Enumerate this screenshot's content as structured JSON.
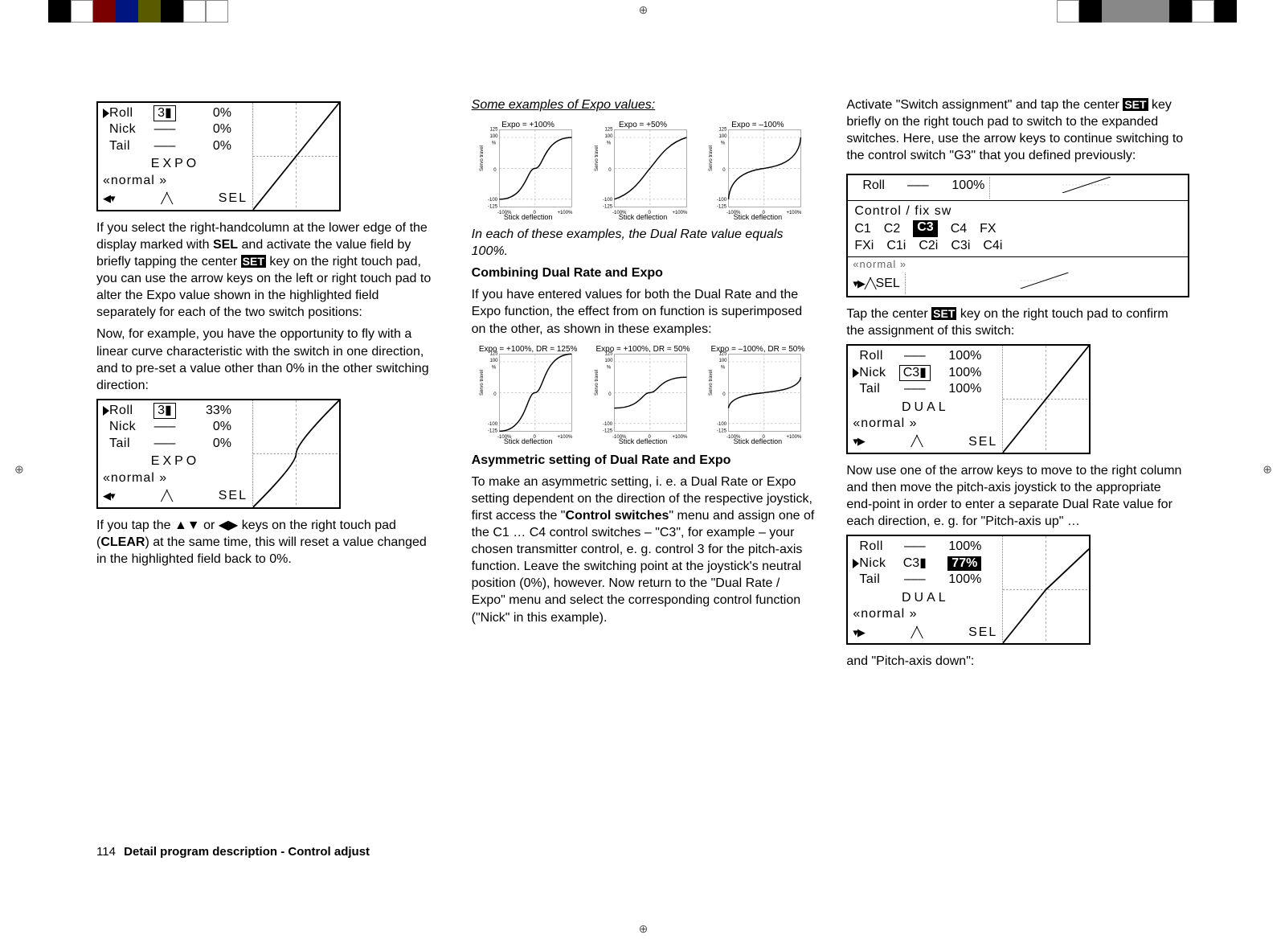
{
  "footer": {
    "page_number": "114",
    "text": "Detail program description - Control adjust"
  },
  "colors": {
    "set_key_bg": "#000000",
    "set_key_fg": "#ffffff"
  },
  "column1": {
    "lcd1": {
      "rows": [
        {
          "label": "Roll",
          "sw": "3",
          "boxed": true,
          "pct": "0%",
          "selected": true
        },
        {
          "label": "Nick",
          "sw": "–––",
          "boxed": false,
          "pct": "0%"
        },
        {
          "label": "Tail",
          "sw": "–––",
          "boxed": false,
          "pct": "0%"
        }
      ],
      "mode": "EXPO",
      "phase": "«normal »",
      "sel": "SEL"
    },
    "p1a": "If you select the right-handcolumn at the lower edge of the display marked with ",
    "p1_sel": "SEL",
    "p1b": " and activate the value field by briefly tapping the center ",
    "p1_set": "SET",
    "p1c": " key on the right touch pad, you can use the arrow keys on the left or right touch pad to alter the Expo value shown in the highlighted field separately for each of the two switch positions:",
    "p2": "Now, for example, you have the opportunity to fly with a linear curve characteristic with the switch in one direction, and to pre-set a value other than 0% in the other switching direction:",
    "lcd2": {
      "rows": [
        {
          "label": "Roll",
          "sw": "3",
          "boxed": true,
          "pct": "33%",
          "selected": true
        },
        {
          "label": "Nick",
          "sw": "–––",
          "boxed": false,
          "pct": "0%"
        },
        {
          "label": "Tail",
          "sw": "–––",
          "boxed": false,
          "pct": "0%"
        }
      ],
      "mode": "EXPO",
      "phase": "«normal »",
      "sel": "SEL"
    },
    "p3a": "If you tap the ▲▼ or ◀▶ keys on the right touch pad (",
    "p3_clear": "CLEAR",
    "p3b": ") at the same time, this will reset a value changed in the highlighted field back to 0%."
  },
  "column2": {
    "heading1": "Some examples of Expo values:",
    "charts1": [
      {
        "title": "Expo = +100%",
        "xlabel": "Stick deflection"
      },
      {
        "title": "Expo = +50%",
        "xlabel": "Stick deflection"
      },
      {
        "title": "Expo = –100%",
        "xlabel": "Stick deflection"
      }
    ],
    "caption1": "In each of these examples, the Dual Rate value equals 100%.",
    "heading2": "Combining Dual Rate and Expo",
    "p1": "If you have entered values for both the Dual Rate and the Expo function, the effect from on function is superimposed on the other, as shown in these examples:",
    "charts2": [
      {
        "title": "Expo = +100%, DR = 125%",
        "xlabel": "Stick deflection"
      },
      {
        "title": "Expo = +100%, DR = 50%",
        "xlabel": "Stick deflection"
      },
      {
        "title": "Expo = –100%, DR = 50%",
        "xlabel": "Stick deflection"
      }
    ],
    "heading3": "Asymmetric setting of Dual Rate and Expo",
    "p2a": "To make an asymmetric setting, i. e. a Dual Rate or Expo setting dependent on the direction of the respective joystick, first access the \"",
    "p2_bold": "Control switches",
    "p2b": "\" menu and assign one of the C1 … C4 control switches – \"C3\", for example – your chosen transmitter control, e. g. control 3 for the pitch-axis function. Leave the switching point at the joystick's neutral position (0%), however. Now return to the \"Dual Rate / Expo\" menu and select the corresponding control function (\"Nick\" in this example)."
  },
  "column3": {
    "p1a": "Activate \"Switch assignment\" and tap the center ",
    "p1_set": "SET",
    "p1b": " key briefly on the right touch pad to switch to the expanded switches. Here, use the arrow keys to continue switching to the control switch \"G3\" that you defined previously:",
    "lcd_sw": {
      "top_label": "Roll",
      "top_sw": "–––",
      "top_pct": "100%",
      "title": "Control / fix  sw",
      "row1": [
        "C1",
        "C2",
        "C3",
        "C4",
        "FX"
      ],
      "row1_selected_index": 2,
      "row2": [
        "FXi",
        "C1i",
        "C2i",
        "C3i",
        "C4i"
      ],
      "under": "«normal »",
      "sel": "SEL"
    },
    "p2a": "Tap the center ",
    "p2_set": "SET",
    "p2b": " key on the right touch pad to confirm the assignment of this switch:",
    "lcd2": {
      "rows": [
        {
          "label": "Roll",
          "sw": "–––",
          "boxed": false,
          "pct": "100%"
        },
        {
          "label": "Nick",
          "sw": "C3",
          "boxed": true,
          "pct": "100%",
          "selected": true
        },
        {
          "label": "Tail",
          "sw": "–––",
          "boxed": false,
          "pct": "100%"
        }
      ],
      "mode": "DUAL",
      "phase": "«normal »",
      "sel": "SEL"
    },
    "p3": "Now use one of the arrow keys to move to the right column and then move the pitch-axis joystick to the appropriate end-point in order to enter a separate Dual Rate value for each direction, e. g. for \"Pitch-axis up\" …",
    "lcd3": {
      "rows": [
        {
          "label": "Roll",
          "sw": "–––",
          "boxed": false,
          "pct": "100%"
        },
        {
          "label": "Nick",
          "sw": "C3",
          "boxed": false,
          "pct": "77%",
          "selected": true,
          "pct_inverted": true
        },
        {
          "label": "Tail",
          "sw": "–––",
          "boxed": false,
          "pct": "100%"
        }
      ],
      "mode": "DUAL",
      "phase": "«normal »",
      "sel": "SEL"
    },
    "p4": "and \"Pitch-axis down\":"
  },
  "chart_data": [
    {
      "type": "line",
      "title": "Expo = +100%",
      "xlabel": "Stick deflection",
      "ylabel": "Servo travel",
      "xlim": [
        -100,
        100
      ],
      "ylim": [
        -125,
        125
      ],
      "xticks": [
        "-100%",
        "0",
        "+100%"
      ],
      "yticks": [
        -125,
        -100,
        0,
        100,
        125
      ],
      "x": [
        -100,
        -75,
        -50,
        -25,
        0,
        25,
        50,
        75,
        100
      ],
      "y": [
        -100,
        -42,
        -12,
        -2,
        0,
        2,
        12,
        42,
        100
      ]
    },
    {
      "type": "line",
      "title": "Expo = +50%",
      "xlabel": "Stick deflection",
      "ylabel": "Servo travel",
      "xlim": [
        -100,
        100
      ],
      "ylim": [
        -125,
        125
      ],
      "xticks": [
        "-100%",
        "0",
        "+100%"
      ],
      "yticks": [
        -125,
        -100,
        0,
        100,
        125
      ],
      "x": [
        -100,
        -75,
        -50,
        -25,
        0,
        25,
        50,
        75,
        100
      ],
      "y": [
        -100,
        -58,
        -30,
        -13,
        0,
        13,
        30,
        58,
        100
      ]
    },
    {
      "type": "line",
      "title": "Expo = –100%",
      "xlabel": "Stick deflection",
      "ylabel": "Servo travel",
      "xlim": [
        -100,
        100
      ],
      "ylim": [
        -125,
        125
      ],
      "xticks": [
        "-100%",
        "0",
        "+100%"
      ],
      "yticks": [
        -125,
        -100,
        0,
        100,
        125
      ],
      "x": [
        -100,
        -75,
        -50,
        -25,
        0,
        25,
        50,
        75,
        100
      ],
      "y": [
        -100,
        -96,
        -87,
        -63,
        0,
        63,
        87,
        96,
        100
      ]
    },
    {
      "type": "line",
      "title": "Expo = +100%, DR = 125%",
      "xlabel": "Stick deflection",
      "ylabel": "Servo travel",
      "xlim": [
        -100,
        100
      ],
      "ylim": [
        -125,
        125
      ],
      "xticks": [
        "-100%",
        "0",
        "+100%"
      ],
      "yticks": [
        -125,
        -100,
        0,
        100,
        125
      ],
      "x": [
        -100,
        -75,
        -50,
        -25,
        0,
        25,
        50,
        75,
        100
      ],
      "y": [
        -125,
        -53,
        -15,
        -2,
        0,
        2,
        15,
        53,
        125
      ]
    },
    {
      "type": "line",
      "title": "Expo = +100%, DR = 50%",
      "xlabel": "Stick deflection",
      "ylabel": "Servo travel",
      "xlim": [
        -100,
        100
      ],
      "ylim": [
        -125,
        125
      ],
      "xticks": [
        "-100%",
        "0",
        "+100%"
      ],
      "yticks": [
        -125,
        -100,
        0,
        100,
        125
      ],
      "x": [
        -100,
        -75,
        -50,
        -25,
        0,
        25,
        50,
        75,
        100
      ],
      "y": [
        -50,
        -21,
        -6,
        -1,
        0,
        1,
        6,
        21,
        50
      ]
    },
    {
      "type": "line",
      "title": "Expo = –100%, DR = 50%",
      "xlabel": "Stick deflection",
      "ylabel": "Servo travel",
      "xlim": [
        -100,
        100
      ],
      "ylim": [
        -125,
        125
      ],
      "xticks": [
        "-100%",
        "0",
        "+100%"
      ],
      "yticks": [
        -125,
        -100,
        0,
        100,
        125
      ],
      "x": [
        -100,
        -75,
        -50,
        -25,
        0,
        25,
        50,
        75,
        100
      ],
      "y": [
        -50,
        -48,
        -44,
        -32,
        0,
        32,
        44,
        48,
        50
      ]
    }
  ]
}
